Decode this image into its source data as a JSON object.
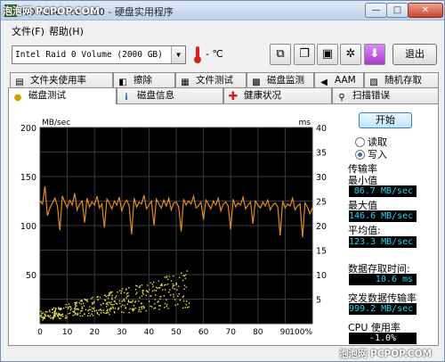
{
  "window": {
    "watermark": "泡泡网 PCPOP.COM",
    "title": "HD Tune Pro 3.50 - 硬盘实用程序",
    "buttons": {
      "minimize": "—",
      "maximize": "□",
      "close": "✕"
    }
  },
  "menu": {
    "file": "文件(F)",
    "help": "帮助(H)"
  },
  "toolbar": {
    "drive": "Intel   Raid 0 Volume (2000 GB)",
    "temperature": "- ℃",
    "icons": [
      "copy-icon",
      "copy-text-icon",
      "save-icon",
      "options-icon",
      "download-icon"
    ],
    "exit_label": "退出"
  },
  "tabs_top": [
    {
      "label": "文件夹使用率",
      "icon": "folder-usage-icon"
    },
    {
      "label": "擦除",
      "icon": "erase-icon"
    },
    {
      "label": "文件测试",
      "icon": "file-test-icon"
    },
    {
      "label": "磁盘监测",
      "icon": "disk-monitor-icon"
    },
    {
      "label": "AAM",
      "icon": "aam-speaker-icon"
    },
    {
      "label": "随机存取",
      "icon": "random-access-icon"
    }
  ],
  "tabs_bottom": [
    {
      "label": "磁盘测试",
      "icon": "benchmark-icon",
      "active": true
    },
    {
      "label": "磁盘信息",
      "icon": "info-icon"
    },
    {
      "label": "健康状况",
      "icon": "health-icon"
    },
    {
      "label": "扫描错误",
      "icon": "error-scan-icon"
    }
  ],
  "controls": {
    "start_label": "开始",
    "read_label": "读取",
    "write_label": "写入",
    "selected_mode": "write"
  },
  "stats": {
    "transfer_rate_label": "传输率",
    "min_label": "最小值",
    "min_value": "86.7 MB/sec",
    "max_label": "最大值",
    "max_value": "146.6 MB/sec",
    "avg_label": "平均值:",
    "avg_value": "123.3 MB/sec",
    "access_time_label": "数据存取时间:",
    "access_time_value": "10.6 ms",
    "burst_label": "突发数据传输率",
    "burst_value": "999.2 MB/sec",
    "cpu_label": "CPU 使用率",
    "cpu_value": "-1.0%"
  },
  "footer_watermark": "泡泡网 PCPOP.COM",
  "chart_data": {
    "type": "line",
    "left_axis_label": "MB/sec",
    "right_axis_label": "ms",
    "left_ticks": [
      200,
      150,
      100,
      50
    ],
    "right_ticks": [
      40,
      35,
      30,
      25,
      20,
      15,
      10,
      5
    ],
    "x_ticks": [
      "0",
      "10",
      "20",
      "30",
      "40",
      "50",
      "60",
      "70",
      "80",
      "90",
      "100%"
    ],
    "ylim": [
      0,
      200
    ],
    "y2lim": [
      0,
      40
    ],
    "grid": true,
    "background": "#000000",
    "transfer_color": "#e68a1a",
    "access_color": "#e6e64a",
    "transfer_series": [
      125,
      122,
      140,
      110,
      118,
      123,
      128,
      120,
      95,
      130,
      124,
      118,
      126,
      121,
      133,
      116,
      122,
      125,
      103,
      128,
      119,
      124,
      121,
      130,
      118,
      122,
      98,
      127,
      123,
      117,
      125,
      121,
      129,
      115,
      122,
      126,
      120,
      91,
      128,
      119,
      124,
      122,
      131,
      117,
      121,
      125,
      100,
      127,
      122,
      118,
      126,
      120,
      128,
      116,
      123,
      124,
      119,
      94,
      127,
      121,
      125,
      122,
      130,
      118,
      120,
      124,
      106,
      126,
      122,
      117,
      125,
      121,
      128,
      115,
      122,
      124,
      120,
      96,
      127,
      119,
      123,
      121,
      129,
      117,
      121,
      124,
      102,
      125,
      121,
      118,
      124,
      120,
      126,
      116,
      121,
      123,
      119,
      90,
      125,
      118,
      122,
      120,
      128,
      116,
      120,
      122,
      88,
      123,
      119,
      112,
      118
    ],
    "access_description": "scatter of access time points rising from ~2 ms at 0% to ~10 ms near 50%"
  }
}
